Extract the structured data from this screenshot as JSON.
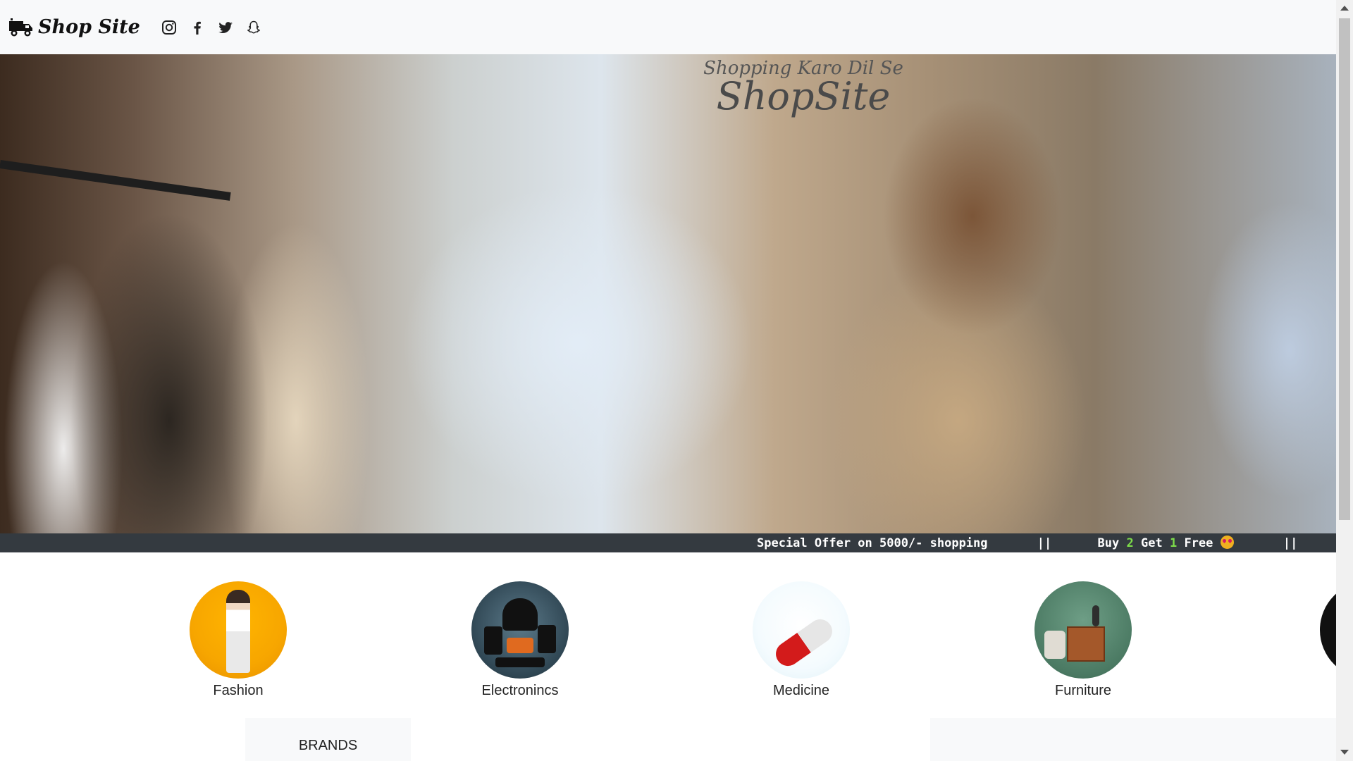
{
  "navbar": {
    "brand": "Shop Site",
    "brand_icon": "truck-icon",
    "socials": [
      {
        "name": "instagram",
        "icon": "instagram-icon"
      },
      {
        "name": "facebook",
        "icon": "facebook-icon"
      },
      {
        "name": "twitter",
        "icon": "twitter-icon"
      },
      {
        "name": "snapchat",
        "icon": "snapchat-icon"
      }
    ]
  },
  "hero": {
    "tagline": "Shopping Karo Dil Se",
    "title": "ShopSite"
  },
  "ticker": {
    "offer_text": "Special Offer on 5000/- shopping",
    "separator": "||",
    "buy_label": "Buy",
    "buy_count": "2",
    "get_label": "Get",
    "get_count": "1",
    "free_label": "Free",
    "emoji": "heart-eyes-emoji",
    "separator_end": "||"
  },
  "categories": [
    {
      "label": "Fashion"
    },
    {
      "label": "Electronincs"
    },
    {
      "label": "Medicine"
    },
    {
      "label": "Furniture"
    }
  ],
  "sections": {
    "brands_title": "BRANDS"
  },
  "colors": {
    "navbar_bg": "#f8f9fa",
    "ticker_bg": "#343a40",
    "ticker_number": "#7ddc4a"
  }
}
